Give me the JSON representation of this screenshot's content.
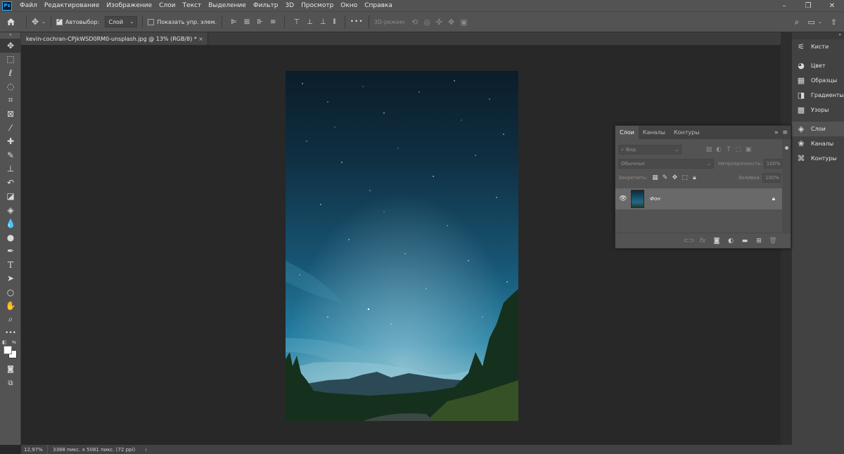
{
  "menubar": {
    "logo": "Ps",
    "items": [
      "Файл",
      "Редактирование",
      "Изображение",
      "Слои",
      "Текст",
      "Выделение",
      "Фильтр",
      "3D",
      "Просмотр",
      "Окно",
      "Справка"
    ],
    "window_controls": [
      "–",
      "❐",
      "✕"
    ]
  },
  "options": {
    "autoselect_label": "Автовыбор:",
    "autoselect_value": "Слой",
    "show_transform_label": "Показать упр. элем.",
    "more": "•••",
    "mode_3d": "3D-режим:"
  },
  "document": {
    "tab_title": "kevin-cochran-CPjkWSD0RM0-unsplash.jpg @ 13% (RGB/8) *",
    "close": "×"
  },
  "status": {
    "zoom": "12,97%",
    "dimensions": "3388 пикс. x 5081 пикс. (72 ppi)",
    "arrow": "›"
  },
  "dock": {
    "items": [
      {
        "label": "Кисти",
        "icon": "brush-settings-icon"
      },
      {
        "label": "Цвет",
        "icon": "color-palette-icon"
      },
      {
        "label": "Образцы",
        "icon": "swatches-grid-icon"
      },
      {
        "label": "Градиенты",
        "icon": "gradient-icon"
      },
      {
        "label": "Узоры",
        "icon": "patterns-icon"
      },
      {
        "label": "Слои",
        "icon": "layers-stack-icon"
      },
      {
        "label": "Каналы",
        "icon": "channels-icon"
      },
      {
        "label": "Контуры",
        "icon": "paths-icon"
      }
    ]
  },
  "layers_panel": {
    "tabs": [
      "Слои",
      "Каналы",
      "Контуры"
    ],
    "filter_placeholder": "Вид",
    "blend_mode": "Обычные",
    "opacity_label": "Непрозрачность:",
    "opacity_value": "100%",
    "lock_label": "Закрепить:",
    "fill_label": "Заливка:",
    "fill_value": "100%",
    "layers": [
      {
        "name": "Фон",
        "visible": true,
        "locked": true
      }
    ]
  },
  "colors": {
    "foreground": "#ffffff",
    "background": "#ffffff",
    "ps_brand": "#31a8ff"
  }
}
